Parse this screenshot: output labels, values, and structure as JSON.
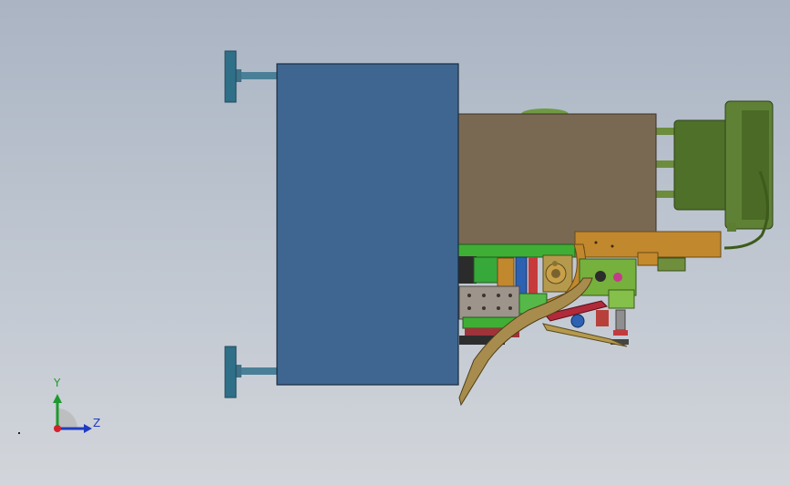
{
  "viewport": {
    "background_top": "#aab4c3",
    "background_bottom": "#d2d5da"
  },
  "triad": {
    "y_label": "Y",
    "z_label": "Z",
    "y_color": "#1d9a2c",
    "z_color": "#1f3cc0",
    "origin_color": "#d8202a"
  },
  "model": {
    "colors": {
      "blue_plate": "#3e6690",
      "brown_box": "#7a6952",
      "motor_green": "#5a7a33",
      "handwheel": "#4a7f98",
      "tan_frame": "#a88c4d",
      "orange_bracket": "#c1882d",
      "steel_block": "#8f8a85",
      "red_link": "#b02a3a",
      "bright_green": "#3fae35"
    }
  }
}
